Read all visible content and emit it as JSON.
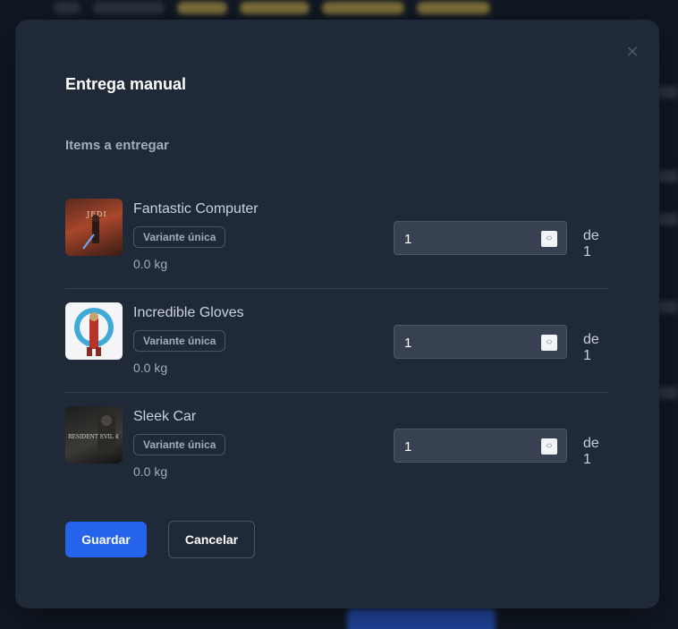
{
  "modal": {
    "title": "Entrega manual",
    "close_icon": "close-icon",
    "section_title": "Items a entregar",
    "items": [
      {
        "name": "Fantastic Computer",
        "variant": "Variante única",
        "weight": "0.0 kg",
        "quantity": "1",
        "of_label": "de 1"
      },
      {
        "name": "Incredible Gloves",
        "variant": "Variante única",
        "weight": "0.0 kg",
        "quantity": "1",
        "of_label": "de 1"
      },
      {
        "name": "Sleek Car",
        "variant": "Variante única",
        "weight": "0.0 kg",
        "quantity": "1",
        "of_label": "de 1"
      }
    ],
    "save_label": "Guardar",
    "cancel_label": "Cancelar"
  },
  "colors": {
    "modal_bg": "#1f2937",
    "primary": "#2563eb",
    "input_bg": "#374151",
    "divider": "#374151"
  }
}
